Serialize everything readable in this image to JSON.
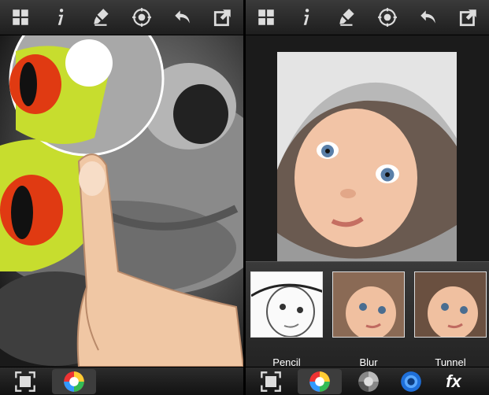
{
  "toolbar": {
    "icons": [
      "grid-icon",
      "info-icon",
      "brush-icon",
      "target-icon",
      "undo-icon",
      "share-icon"
    ]
  },
  "bottombar": {
    "left_icons": [
      "fit-screen-icon",
      "color-wheel-icon"
    ],
    "right_icons": [
      "fit-screen-icon",
      "color-wheel-icon",
      "gray-wheel-icon",
      "blue-wheel-icon"
    ],
    "fx_label": "fx"
  },
  "filters": [
    {
      "label": "Pencil"
    },
    {
      "label": "Blur"
    },
    {
      "label": "Tunnel"
    }
  ],
  "colors": {
    "toolbar_bg": "#2a2a2a",
    "frog_green": "#c7dd2e",
    "frog_eye": "#e03a12",
    "skin": "#f0c7a4"
  }
}
